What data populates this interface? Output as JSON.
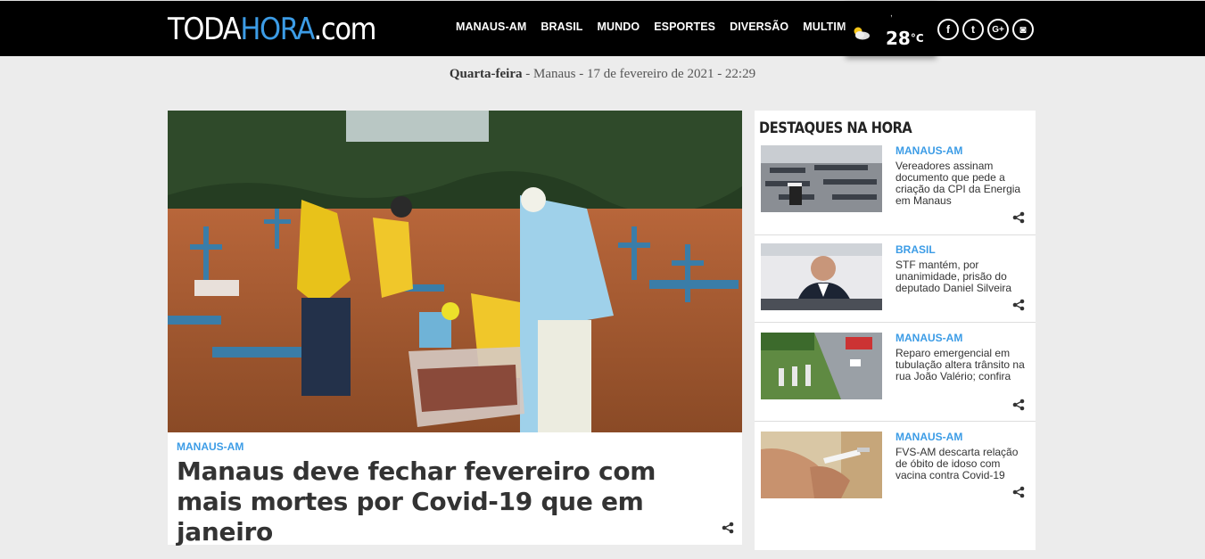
{
  "header": {
    "logo": {
      "part1": "TODA",
      "part2": "HORA",
      "part3": ".com"
    },
    "nav": [
      "MANAUS-AM",
      "BRASIL",
      "MUNDO",
      "ESPORTES",
      "DIVERSÃO",
      "MULTIMÍDIA"
    ],
    "weather": {
      "temp": "28",
      "unit": "°C",
      "icon": "partly-cloudy-icon"
    },
    "social": [
      {
        "icon": "facebook-icon",
        "glyph": "f"
      },
      {
        "icon": "twitter-icon",
        "glyph": "t"
      },
      {
        "icon": "google-plus-icon",
        "glyph": "G+"
      },
      {
        "icon": "instagram-icon",
        "glyph": "◙"
      }
    ]
  },
  "dateline": {
    "weekday": "Quarta-feira",
    "rest": " - Manaus - 17 de fevereiro de 2021 - 22:29"
  },
  "main_story": {
    "category": "MANAUS-AM",
    "title": "Manaus deve fechar fevereiro com mais mortes por Covid-19 que em janeiro"
  },
  "sidebar": {
    "title": "DESTAQUES NA HORA",
    "items": [
      {
        "category": "MANAUS-AM",
        "title": "Vereadores assinam documento que pede a criação da CPI da Energia em Manaus"
      },
      {
        "category": "BRASIL",
        "title": "STF mantém, por unanimidade, prisão do deputado Daniel Silveira"
      },
      {
        "category": "MANAUS-AM",
        "title": "Reparo emergencial em tubulação altera trânsito na rua João Valério; confira"
      },
      {
        "category": "MANAUS-AM",
        "title": "FVS-AM descarta relação de óbito de idoso com vacina contra Covid-19"
      }
    ]
  },
  "colors": {
    "accent": "#3c9ce6",
    "header_bg": "#000000",
    "page_bg": "#ececec"
  }
}
